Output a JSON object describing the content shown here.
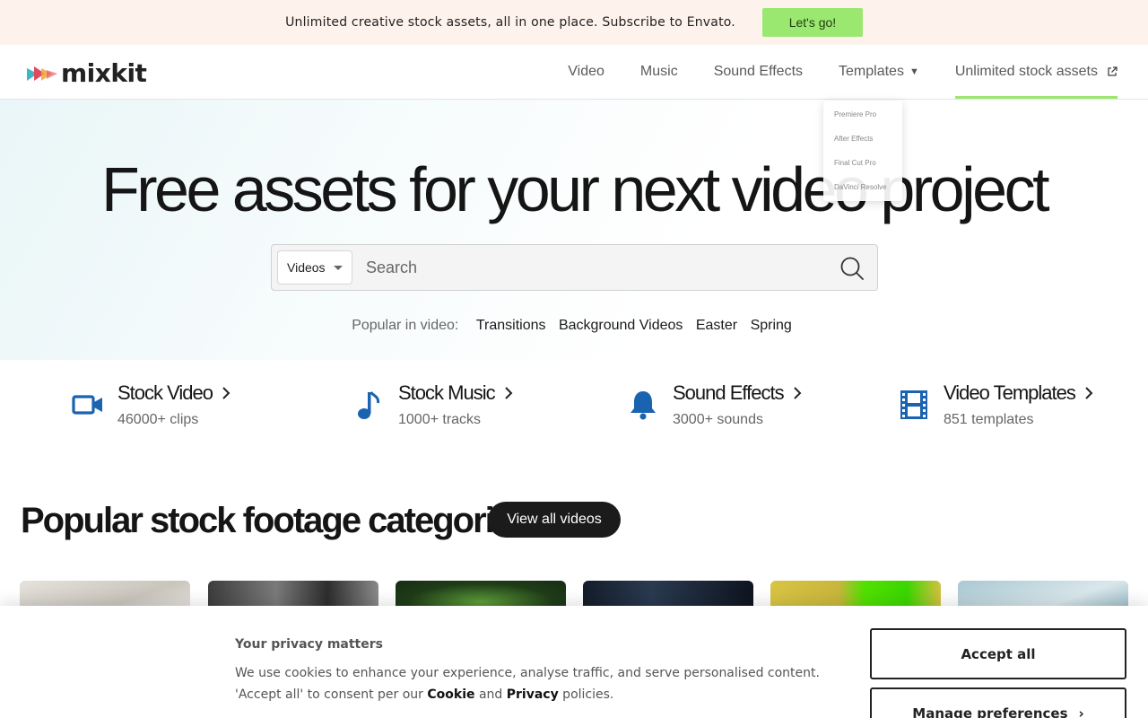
{
  "promo": {
    "text": "Unlimited creative stock assets, all in one place. Subscribe to Envato.",
    "button": "Let's go!"
  },
  "header": {
    "logo_text": "mixkit",
    "nav": [
      {
        "label": "Video"
      },
      {
        "label": "Music"
      },
      {
        "label": "Sound Effects"
      },
      {
        "label": "Templates"
      },
      {
        "label": "Unlimited stock assets"
      }
    ]
  },
  "templates_dropdown": [
    "Premiere Pro",
    "After Effects",
    "Final Cut Pro",
    "DaVinci Resolve"
  ],
  "hero": {
    "headline": "Free assets for your next video project",
    "search": {
      "type_selected": "Videos",
      "placeholder": "Search"
    },
    "popular_label": "Popular in video:",
    "popular_tags": [
      "Transitions",
      "Background Videos",
      "Easter",
      "Spring"
    ]
  },
  "categories": [
    {
      "title": "Stock Video",
      "subtitle": "46000+ clips",
      "icon": "video-camera-icon"
    },
    {
      "title": "Stock Music",
      "subtitle": "1000+ tracks",
      "icon": "music-note-icon"
    },
    {
      "title": "Sound Effects",
      "subtitle": "3000+ sounds",
      "icon": "bell-icon"
    },
    {
      "title": "Video Templates",
      "subtitle": "851 templates",
      "icon": "film-strip-icon"
    }
  ],
  "popular_section": {
    "title": "Popular stock footage categories",
    "view_all": "View all videos"
  },
  "cookie": {
    "title": "Your privacy matters",
    "body_part1": "We use cookies to enhance your experience, analyse traffic, and serve personalised content. 'Accept all' to consent per our ",
    "cookie_link": "Cookie",
    "and_text": " and ",
    "privacy_link": "Privacy",
    "body_part2": " policies.",
    "accept_all": "Accept all",
    "manage": "Manage preferences"
  },
  "colors": {
    "accent_green": "#9ae870",
    "icon_blue": "#1a63b0",
    "promo_bg": "#fdf2ec"
  }
}
